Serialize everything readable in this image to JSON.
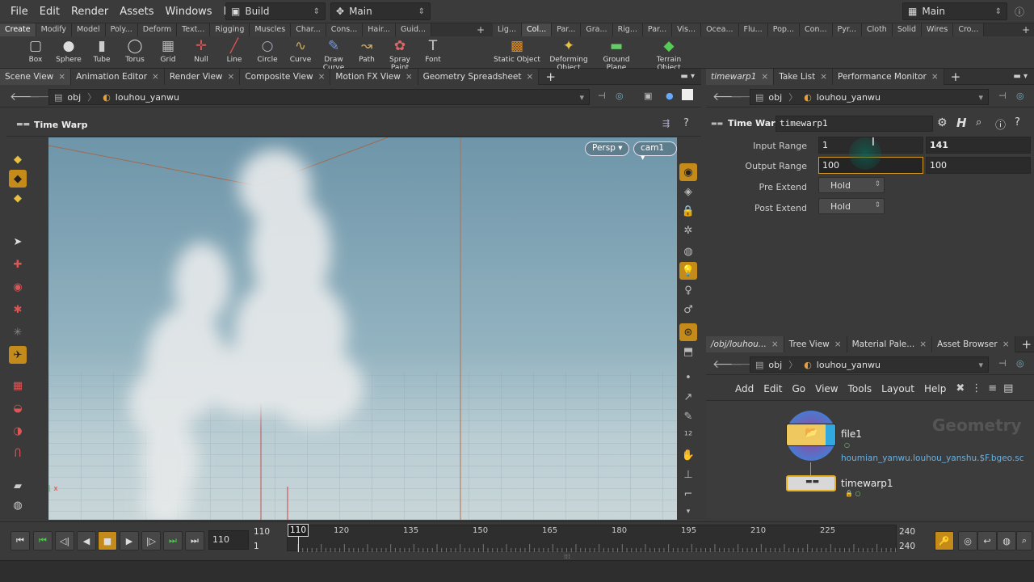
{
  "menubar": {
    "items": [
      "File",
      "Edit",
      "Render",
      "Assets",
      "Windows",
      "Help"
    ],
    "desktop": "Build",
    "context": "Main",
    "right_desktop": "Main"
  },
  "shelf_tabs_left": [
    "Create",
    "Modify",
    "Model",
    "Poly...",
    "Deform",
    "Text...",
    "Rigging",
    "Muscles",
    "Char...",
    "Cons...",
    "Hair...",
    "Guid..."
  ],
  "shelf_tabs_right": [
    "Lig...",
    "Col...",
    "Par...",
    "Gra...",
    "Rig...",
    "Par...",
    "Vis...",
    "Ocea...",
    "Flu...",
    "Pop...",
    "Con...",
    "Pyr...",
    "Cloth",
    "Solid",
    "Wires",
    "Cro..."
  ],
  "shelf_tools_left": [
    "Box",
    "Sphere",
    "Tube",
    "Torus",
    "Grid",
    "Null",
    "Line",
    "Circle",
    "Curve",
    "Draw Curve",
    "Path",
    "Spray Paint",
    "Font"
  ],
  "shelf_tools_right": [
    "Static Object",
    "Deforming Object",
    "Ground Plane",
    "Terrain Object"
  ],
  "left_pane": {
    "tabs": [
      "Scene View",
      "Animation Editor",
      "Render View",
      "Composite View",
      "Motion FX View",
      "Geometry Spreadsheet"
    ],
    "path": [
      "obj",
      "louhou_yanwu"
    ],
    "title": "Time Warp",
    "persp": "Persp",
    "cam": "cam1"
  },
  "param_pane": {
    "tabs": [
      "timewarp1",
      "Take List",
      "Performance Monitor"
    ],
    "path": [
      "obj",
      "louhou_yanwu"
    ],
    "node_type": "Time Warp",
    "node_name": "timewarp1",
    "params": [
      {
        "label": "Input Range",
        "v1": "1",
        "v2": "141"
      },
      {
        "label": "Output Range",
        "v1": "100",
        "v2": "100"
      },
      {
        "label": "Pre Extend",
        "v1": "Hold"
      },
      {
        "label": "Post Extend",
        "v1": "Hold"
      }
    ]
  },
  "network_pane": {
    "tabs": [
      "/obj/louhou...",
      "Tree View",
      "Material Pale...",
      "Asset Browser"
    ],
    "path": [
      "obj",
      "louhou_yanwu"
    ],
    "menu": [
      "Add",
      "Edit",
      "Go",
      "View",
      "Tools",
      "Layout",
      "Help"
    ],
    "watermark": "Geometry",
    "nodes": [
      {
        "name": "file1",
        "sub": "houmian_yanwu.louhou_yanshu.$F.bgeo.sc"
      },
      {
        "name": "timewarp1"
      }
    ]
  },
  "timeline": {
    "current": "110",
    "start": "1",
    "range_start": "110",
    "range_end": "240",
    "end": "240",
    "marker": "110",
    "ticks": [
      "120",
      "135",
      "150",
      "165",
      "180",
      "195",
      "210",
      "225"
    ]
  },
  "colors": {
    "accent": "#c48a1a",
    "sky": "#7fa3b4"
  }
}
